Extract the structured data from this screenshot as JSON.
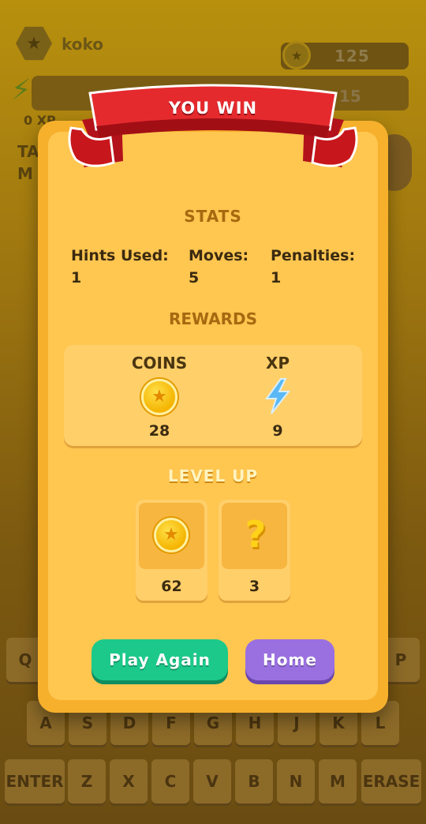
{
  "background": {
    "username": "koko",
    "coins": "125",
    "level_value": "15",
    "xp_label": "0 XP",
    "partial_text_1": "TA",
    "partial_text_2": "M",
    "keyboard": {
      "row1": [
        "Q",
        "P"
      ],
      "row2": [
        "A",
        "S",
        "D",
        "F",
        "G",
        "H",
        "J",
        "K",
        "L"
      ],
      "row3": [
        "ENTER",
        "Z",
        "X",
        "C",
        "V",
        "B",
        "N",
        "M",
        "ERASE"
      ]
    }
  },
  "modal": {
    "banner_title": "YOU WIN",
    "stats_title": "STATS",
    "stats": [
      {
        "label": "Hints Used:",
        "value": "1"
      },
      {
        "label": "Moves:",
        "value": "5"
      },
      {
        "label": "Penalties:",
        "value": "1"
      }
    ],
    "rewards_title": "REWARDS",
    "rewards": [
      {
        "label": "COINS",
        "value": "28",
        "icon": "coin-icon"
      },
      {
        "label": "XP",
        "value": "9",
        "icon": "lightning-icon"
      }
    ],
    "level_up_title": "LEVEL UP",
    "level_up": [
      {
        "value": "62",
        "icon": "coin-icon"
      },
      {
        "value": "3",
        "icon": "question-mark-icon"
      }
    ],
    "buttons": {
      "play_again": "Play Again",
      "home": "Home"
    }
  },
  "colors": {
    "modal": "#f6b02c",
    "play_again": "#1cc98a",
    "home": "#9a70e0",
    "ribbon": "#e52a2e"
  }
}
